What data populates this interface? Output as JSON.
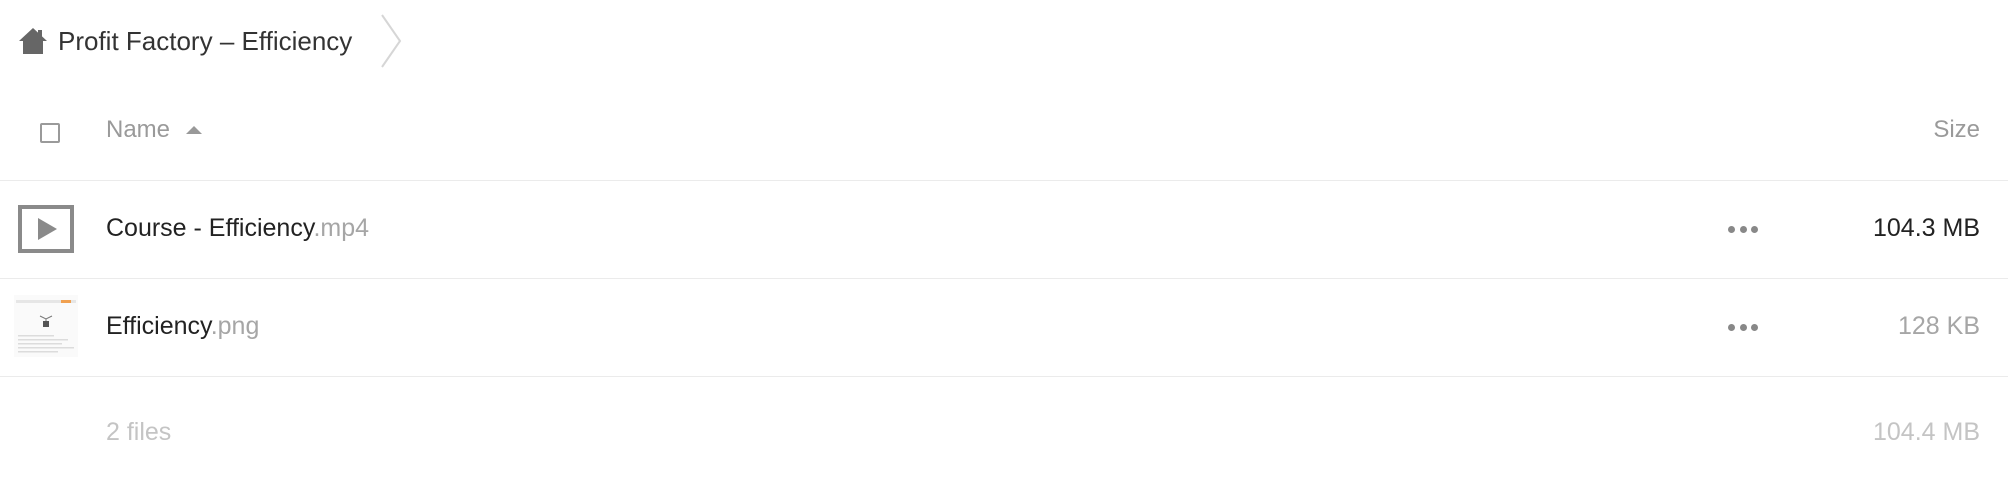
{
  "breadcrumb": {
    "home_icon": "home-icon",
    "title": "Profit Factory – Efficiency",
    "separator_icon": "chevron-right-icon"
  },
  "table": {
    "columns": {
      "name": "Name",
      "size": "Size",
      "sort": "ascending"
    },
    "files": [
      {
        "name": "Course - Efficiency",
        "ext": ".mp4",
        "size": "104.3 MB",
        "icon": "video-file-icon"
      },
      {
        "name": "Efficiency",
        "ext": ".png",
        "size": "128 KB",
        "icon": "image-thumbnail"
      }
    ],
    "summary": {
      "count": "2 files",
      "size": "104.4 MB"
    }
  },
  "colors": {
    "text": "#222222",
    "muted": "#a6a6a6",
    "divider": "#ebebeb",
    "icon": "#888888"
  }
}
